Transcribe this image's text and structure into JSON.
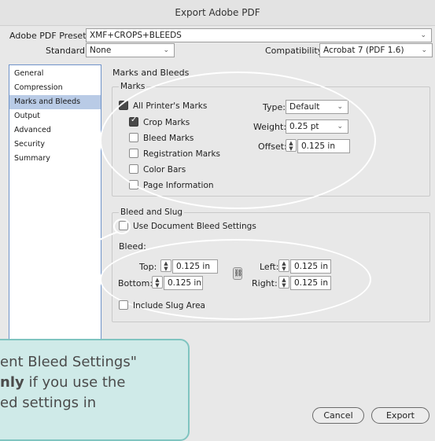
{
  "window": {
    "title": "Export Adobe PDF"
  },
  "preset": {
    "label": "Adobe PDF Preset:",
    "value": "XMF+CROPS+BLEEDS"
  },
  "standard": {
    "label": "Standard:",
    "value": "None"
  },
  "compatibility": {
    "label": "Compatibility:",
    "value": "Acrobat 7 (PDF 1.6)"
  },
  "sidebar": {
    "items": [
      {
        "label": "General"
      },
      {
        "label": "Compression"
      },
      {
        "label": "Marks and Bleeds",
        "selected": true
      },
      {
        "label": "Output"
      },
      {
        "label": "Advanced"
      },
      {
        "label": "Security"
      },
      {
        "label": "Summary"
      }
    ]
  },
  "panel": {
    "title": "Marks and Bleeds"
  },
  "marks": {
    "group_label": "Marks",
    "all_printers_marks": {
      "label": "All Printer's Marks",
      "checked": true
    },
    "crop_marks": {
      "label": "Crop Marks",
      "checked": true
    },
    "bleed_marks": {
      "label": "Bleed Marks",
      "checked": false
    },
    "registration_marks": {
      "label": "Registration Marks",
      "checked": false
    },
    "color_bars": {
      "label": "Color Bars",
      "checked": false
    },
    "page_information": {
      "label": "Page Information",
      "checked": false
    },
    "type": {
      "label": "Type:",
      "value": "Default"
    },
    "weight": {
      "label": "Weight:",
      "value": "0.25 pt"
    },
    "offset": {
      "label": "Offset:",
      "value": "0.125 in"
    }
  },
  "bleed": {
    "group_label": "Bleed and Slug",
    "use_document": {
      "label": "Use Document Bleed Settings",
      "checked": false
    },
    "bleed_label": "Bleed:",
    "top": {
      "label": "Top:",
      "value": "0.125 in"
    },
    "bottom": {
      "label": "Bottom:",
      "value": "0.125 in"
    },
    "left": {
      "label": "Left:",
      "value": "0.125 in"
    },
    "right": {
      "label": "Right:",
      "value": "0.125 in"
    },
    "include_slug": {
      "label": "Include Slug Area",
      "checked": false
    }
  },
  "buttons": {
    "cancel": "Cancel",
    "export": "Export"
  },
  "callout": {
    "line1": "ent Bleed Settings\"",
    "line2_bold": "nly",
    "line2_rest": " if you use the",
    "line3": "ed settings in"
  },
  "colors": {
    "annotation": "#ffffff",
    "callout_bg": "#cfeae8",
    "selection": "#b9cbe6"
  }
}
